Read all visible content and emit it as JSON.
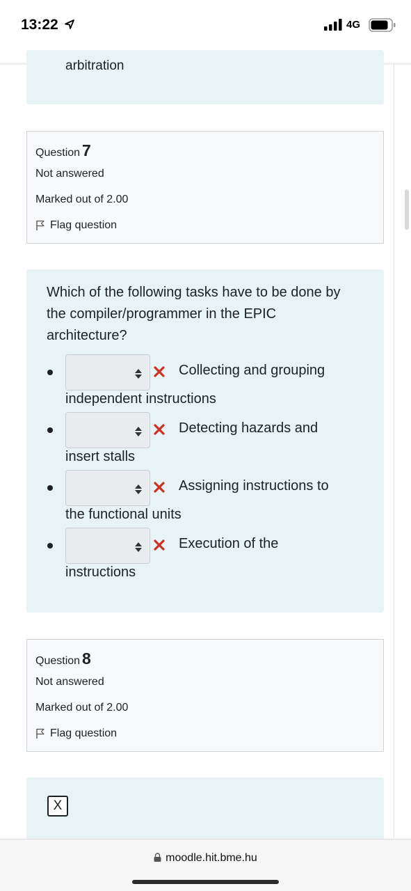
{
  "status_bar": {
    "time": "13:22",
    "network": "4G",
    "icons": [
      "location-arrow-icon",
      "signal-bars-icon",
      "battery-icon"
    ]
  },
  "previous_question": {
    "cut_text": "arbitration"
  },
  "question7": {
    "label": "Question",
    "number": "7",
    "status": "Not answered",
    "marks": "Marked out of 2.00",
    "flag_label": "Flag question"
  },
  "question7_content": {
    "text": "Which of the following tasks have to be done by the compiler/programmer in the EPIC architecture?",
    "items": [
      {
        "line1": "Collecting and grouping",
        "line2": "independent instructions"
      },
      {
        "line1": "Detecting hazards and",
        "line2": "insert stalls"
      },
      {
        "line1": "Assigning instructions to",
        "line2": "the functional units"
      },
      {
        "line1": "Execution of the",
        "line2": "instructions"
      }
    ]
  },
  "question8": {
    "label": "Question",
    "number": "8",
    "status": "Not answered",
    "marks": "Marked out of 2.00",
    "flag_label": "Flag question"
  },
  "question8_content": {
    "box_text": "X"
  },
  "browser": {
    "url": "moodle.hit.bme.hu"
  },
  "colors": {
    "content_bg": "#e7f3f5",
    "info_bg": "#f8f9fa",
    "incorrect": "#ca3120"
  }
}
